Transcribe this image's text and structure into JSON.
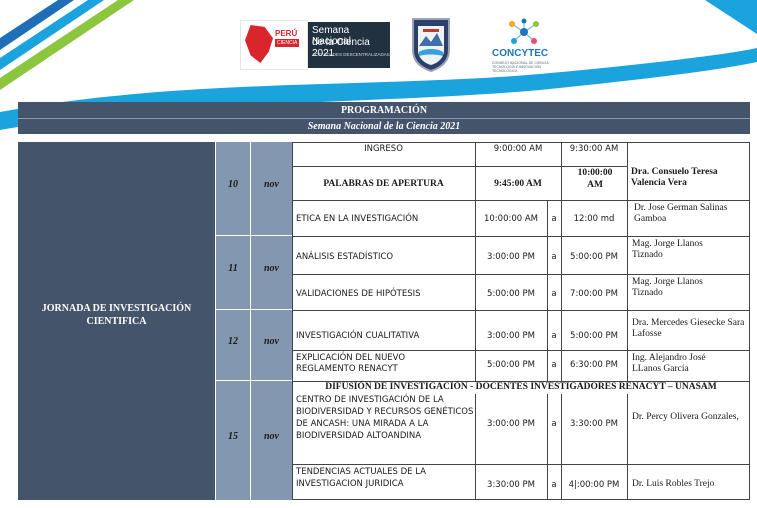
{
  "header": {
    "logos": {
      "peru": {
        "brand": "PERÚ",
        "tag": "CIENCIA"
      },
      "semana": {
        "line1": "Semana Nacional",
        "line2": "de la Ciencia 2021",
        "line3": "ACTIVIDADES DESCENTRALIZADAS"
      },
      "concytec": {
        "name": "CONCYTEC",
        "subtitle": "CONSEJO NACIONAL DE CIENCIA, TECNOLOGÍA E INNOVACIÓN TECNOLÓGICA"
      }
    }
  },
  "table": {
    "title": "PROGRAMACIÓN",
    "subtitle": "Semana Nacional de la Ciencia 2021",
    "section_label": "JORNADA DE INVESTIGACIÓN CIENTIFICA",
    "connector": "a",
    "days": [
      {
        "day": "10",
        "month": "nov"
      },
      {
        "day": "11",
        "month": "nov"
      },
      {
        "day": "12",
        "month": "nov"
      },
      {
        "day": "15",
        "month": "nov"
      }
    ],
    "rows": [
      {
        "activity": "INGRESO",
        "start": "9:00:00 AM",
        "end": "9:30:00 AM",
        "speaker": ""
      },
      {
        "activity": "PALABRAS DE APERTURA",
        "start": "9:45:00 AM",
        "end": "10:00:00 AM",
        "speaker": "Dra. Consuelo Teresa Valencia Vera"
      },
      {
        "activity": "ETICA EN LA INVESTIGACIÓN",
        "start": "10:00:00 AM",
        "end": "12:00 md",
        "speaker": "Dr. Jose German Salinas Gamboa"
      },
      {
        "activity": "ANÁLISIS ESTADÍSTICO",
        "start": "3:00:00 PM",
        "end": "5:00:00 PM",
        "speaker": "Mag. Jorge Llanos Tiznado"
      },
      {
        "activity": "VALIDACIONES DE HIPÓTESIS",
        "start": "5:00:00 PM",
        "end": "7:00:00 PM",
        "speaker": "Mag. Jorge Llanos Tiznado"
      },
      {
        "activity": "INVESTIGACIÓN CUALITATIVA",
        "start": "3:00:00 PM",
        "end": "5:00:00 PM",
        "speaker": "Dra. Mercedes Giesecke Sara Lafosse"
      },
      {
        "activity": "EXPLICACIÓN DEL NUEVO REGLAMENTO RENACYT",
        "start": "5:00:00 PM",
        "end": "6:30:00 PM",
        "speaker": "Ing. Alejandro José LLanos García"
      },
      {
        "activity": "CENTRO DE INVESTIGACIÓN DE LA BIODIVERSIDAD Y RECURSOS GENÉTICOS DE ANCASH: UNA MIRADA A LA BIODIVERSIDAD ALTOANDINA",
        "start": "3:00:00 PM",
        "end": "3:30:00 PM",
        "speaker": "Dr. Percy Olivera Gonzales,"
      },
      {
        "activity": "TENDENCIAS ACTUALES DE LA INVESTIGACION JURIDICA",
        "start": "3:30:00 PM",
        "end": "4|:00:00 PM",
        "speaker": "Dr. Luis Robles Trejo"
      }
    ],
    "banner": "DIFUSIÓN DE INVESTIGACIÓN - DOCENTES INVESTIGADORES RENACYT – UNASAM"
  }
}
